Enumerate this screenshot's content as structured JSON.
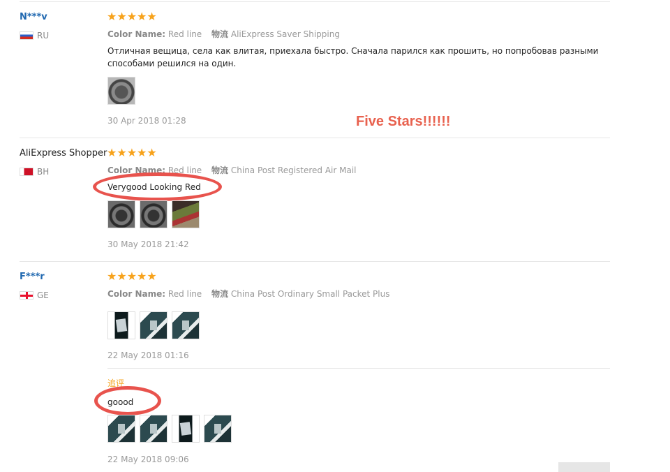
{
  "annotation": {
    "headline": "Five Stars!!!!!!"
  },
  "labels": {
    "color_name": "Color Name:",
    "shipping": "物流"
  },
  "reviews": [
    {
      "user": "N***v",
      "country": "RU",
      "stars": "★★★★★",
      "color": "Red line",
      "shipping": "AliExpress Saver Shipping",
      "text": "Отличная вещица, села как влитая, приехала быстро. Сначала парился как прошить, но попробовав разными способами решился на один.",
      "date": "30 Apr 2018 01:28"
    },
    {
      "user": "AliExpress Shopper",
      "country": "BH",
      "stars": "★★★★★",
      "color": "Red line",
      "shipping": "China Post Registered Air Mail",
      "text": "Verygood Looking Red",
      "date": "30 May 2018 21:42"
    },
    {
      "user": "F***r",
      "country": "GE",
      "stars": "★★★★★",
      "color": "Red line",
      "shipping": "China Post Ordinary Small Packet Plus",
      "date": "22 May 2018 01:16",
      "followup": {
        "label": "追评",
        "text": "goood",
        "date": "22 May 2018 09:06"
      }
    }
  ]
}
